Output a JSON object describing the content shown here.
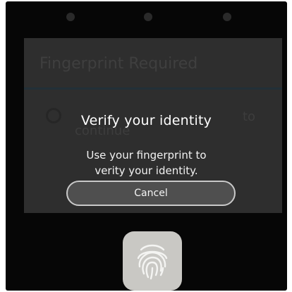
{
  "background_dialog": {
    "title": "Fingerprint Required",
    "body_line1_tail": "to",
    "body_line2": "continue"
  },
  "prompt": {
    "title": "Verify your identity",
    "message_line1": "Use your fingerprint to",
    "message_line2": "verity your identity.",
    "cancel_label": "Cancel"
  },
  "icons": {
    "fingerprint": "fingerprint-icon",
    "background_fingerprint": "fingerprint-small-icon"
  },
  "colors": {
    "frame": "#060606",
    "dim_dialog": "#2e2e2e",
    "text": "#ffffff",
    "button_fill": "#4f4f4f",
    "button_border": "#c9c9c9",
    "fingerprint_tile": "#c9c8c4"
  }
}
